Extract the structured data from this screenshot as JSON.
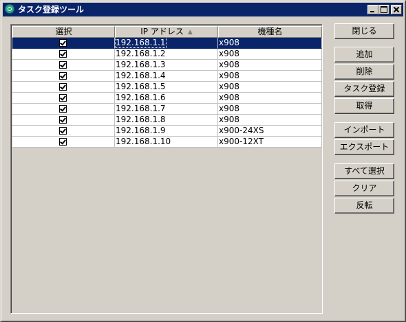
{
  "window": {
    "title": "タスク登録ツール"
  },
  "table": {
    "columns": [
      "選択",
      "IP アドレス",
      "機種名"
    ],
    "sort_indicator": "▲",
    "rows": [
      {
        "checked": true,
        "ip": "192.168.1.1",
        "model": "x908",
        "selected": true
      },
      {
        "checked": true,
        "ip": "192.168.1.2",
        "model": "x908",
        "selected": false
      },
      {
        "checked": true,
        "ip": "192.168.1.3",
        "model": "x908",
        "selected": false
      },
      {
        "checked": true,
        "ip": "192.168.1.4",
        "model": "x908",
        "selected": false
      },
      {
        "checked": true,
        "ip": "192.168.1.5",
        "model": "x908",
        "selected": false
      },
      {
        "checked": true,
        "ip": "192.168.1.6",
        "model": "x908",
        "selected": false
      },
      {
        "checked": true,
        "ip": "192.168.1.7",
        "model": "x908",
        "selected": false
      },
      {
        "checked": true,
        "ip": "192.168.1.8",
        "model": "x908",
        "selected": false
      },
      {
        "checked": true,
        "ip": "192.168.1.9",
        "model": "x900-24XS",
        "selected": false
      },
      {
        "checked": true,
        "ip": "192.168.1.10",
        "model": "x900-12XT",
        "selected": false
      }
    ]
  },
  "buttons": {
    "close": "閉じる",
    "add": "追加",
    "delete": "削除",
    "register_task": "タスク登録",
    "fetch": "取得",
    "import": "インポート",
    "export": "エクスポート",
    "select_all": "すべて選択",
    "clear": "クリア",
    "invert": "反転"
  },
  "colors": {
    "titlebar": "#0a246a",
    "selection": "#0a246a",
    "face": "#d4d0c8"
  }
}
